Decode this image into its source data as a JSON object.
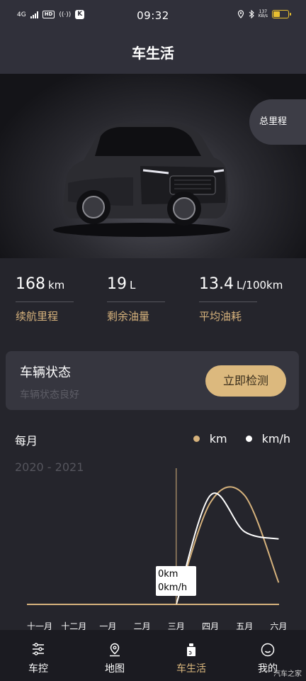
{
  "status_bar": {
    "network": "4G",
    "hd": "HD",
    "app_badge": "K",
    "time": "09:32",
    "net_speed_value": "137",
    "net_speed_unit": "KB/s",
    "battery_level": 0.45
  },
  "header": {
    "title": "车生活"
  },
  "hero": {
    "odometer_button": "总里程"
  },
  "stats": [
    {
      "value": "168",
      "unit": "km",
      "label": "续航里程"
    },
    {
      "value": "19",
      "unit": "L",
      "label": "剩余油量"
    },
    {
      "value": "13.4",
      "unit": "L/100km",
      "label": "平均油耗"
    }
  ],
  "vehicle_status": {
    "title": "车辆状态",
    "subtitle": "车辆状态良好",
    "check_button": "立即检测"
  },
  "chart_header": {
    "period": "每月",
    "range": "2020 - 2021"
  },
  "chart_data": {
    "type": "line",
    "categories": [
      "十一月",
      "十二月",
      "一月",
      "二月",
      "三月",
      "四月",
      "五月",
      "六月"
    ],
    "series": [
      {
        "name": "km",
        "color": "#d6b27c",
        "values": [
          0,
          0,
          0,
          0,
          0,
          70,
          75,
          15
        ]
      },
      {
        "name": "km/h",
        "color": "#ffffff",
        "values": [
          0,
          0,
          0,
          0,
          0,
          75,
          50,
          45
        ]
      }
    ],
    "legend_position": "top-right",
    "grid": false,
    "ylim": [
      0,
      80
    ],
    "tooltip": {
      "category": "三月",
      "km_text": "0km",
      "speed_text": "0km/h"
    }
  },
  "tabs": [
    {
      "label": "车控",
      "icon": "sliders-icon",
      "active": false
    },
    {
      "label": "地图",
      "icon": "map-pin-icon",
      "active": false
    },
    {
      "label": "车生活",
      "icon": "oil-bottle-icon",
      "active": true
    },
    {
      "label": "我的",
      "icon": "smile-icon",
      "active": false
    }
  ],
  "colors": {
    "accent": "#dcb97e",
    "background": "#25252c",
    "header": "#30303a",
    "tabbar": "#1b1b21"
  },
  "watermark": "汽车之家"
}
